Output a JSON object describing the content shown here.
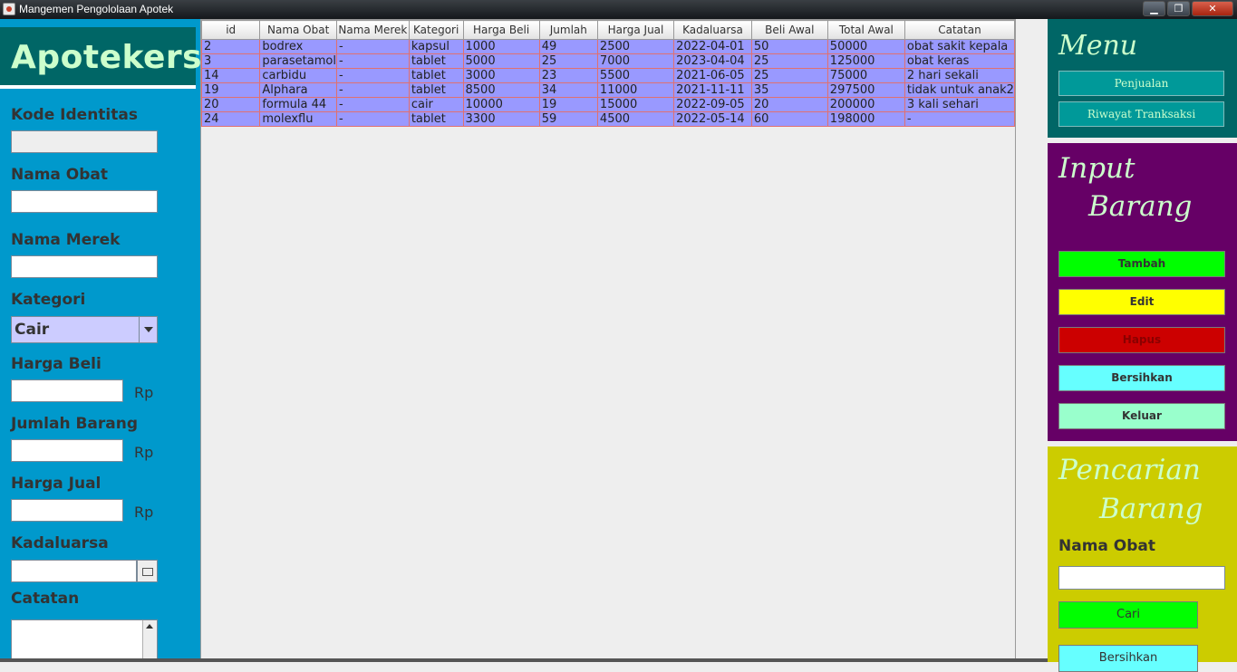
{
  "window": {
    "title": "Mangemen Pengololaan Apotek",
    "minimize_glyph": "▁",
    "maximize_glyph": "❐",
    "close_glyph": "✕"
  },
  "left": {
    "brand": "Apotekers",
    "labels": {
      "kode": "Kode Identitas",
      "nama_obat": "Nama Obat",
      "nama_merek": "Nama Merek",
      "kategori": "Kategori",
      "harga_beli": "Harga Beli",
      "jumlah": "Jumlah Barang",
      "harga_jual": "Harga Jual",
      "kadaluarsa": "Kadaluarsa",
      "catatan": "Catatan"
    },
    "currency": "Rp",
    "kategori_selected": "Cair"
  },
  "table": {
    "headers": [
      "id",
      "Nama Obat",
      "Nama Merek",
      "Kategori",
      "Harga Beli",
      "Jumlah",
      "Harga Jual",
      "Kadaluarsa",
      "Beli Awal",
      "Total Awal",
      "Catatan"
    ],
    "rows": [
      [
        "2",
        "bodrex",
        "-",
        "kapsul",
        "1000",
        "49",
        "2500",
        "2022-04-01",
        "50",
        "50000",
        "obat sakit kepala"
      ],
      [
        "3",
        "parasetamol",
        "-",
        "tablet",
        "5000",
        "25",
        "7000",
        "2023-04-04",
        "25",
        "125000",
        "obat keras"
      ],
      [
        "14",
        "carbidu",
        "-",
        "tablet",
        "3000",
        "23",
        "5500",
        "2021-06-05",
        "25",
        "75000",
        "2 hari sekali"
      ],
      [
        "19",
        "Alphara",
        "-",
        "tablet",
        "8500",
        "34",
        "11000",
        "2021-11-11",
        "35",
        "297500",
        "tidak untuk anak2"
      ],
      [
        "20",
        "formula 44",
        "-",
        "cair",
        "10000",
        "19",
        "15000",
        "2022-09-05",
        "20",
        "200000",
        "3 kali sehari"
      ],
      [
        "24",
        "molexflu",
        "-",
        "tablet",
        "3300",
        "59",
        "4500",
        "2022-05-14",
        "60",
        "198000",
        "-"
      ]
    ]
  },
  "menu": {
    "title": "Menu",
    "penjualan": "Penjualan",
    "riwayat": "Riwayat Tranksaksi"
  },
  "input": {
    "title1": "Input",
    "title2": "Barang",
    "tambah": "Tambah",
    "edit": "Edit",
    "hapus": "Hapus",
    "bersihkan": "Bersihkan",
    "keluar": "Keluar"
  },
  "search": {
    "title1": "Pencarian",
    "title2": "Barang",
    "label": "Nama Obat",
    "cari": "Cari",
    "bersihkan": "Bersihkan"
  },
  "colors": {
    "tambah": "#00ff00",
    "edit": "#ffff00",
    "hapus": "#cc0000",
    "bersihkan": "#66ffff",
    "keluar": "#99ffcc",
    "row_bg": "#9999ff"
  }
}
